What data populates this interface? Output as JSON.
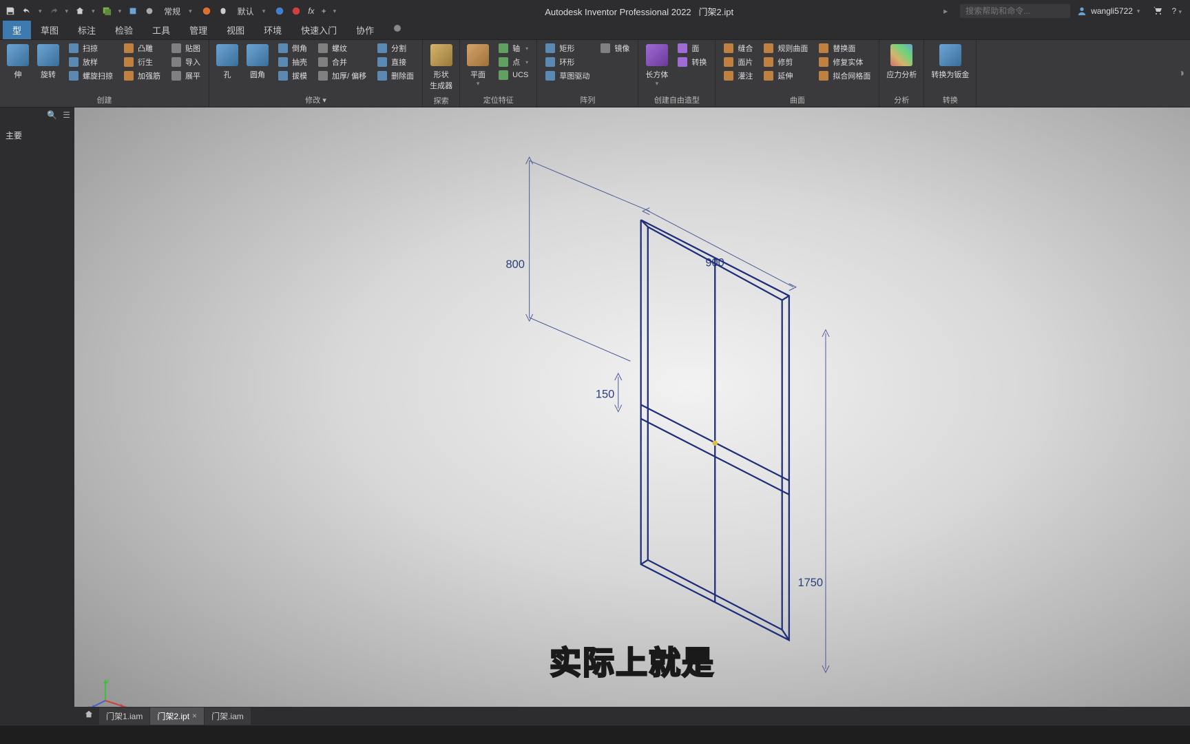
{
  "app": {
    "title": "Autodesk Inventor Professional 2022",
    "filename": "门架2.ipt",
    "search_placeholder": "搜索帮助和命令...",
    "username": "wangli5722"
  },
  "qat_dropdowns": {
    "style": "常规",
    "appearance": "默认"
  },
  "menu_tabs": [
    "型",
    "草图",
    "标注",
    "检验",
    "工具",
    "管理",
    "视图",
    "环境",
    "快速入门",
    "协作"
  ],
  "ribbon": {
    "panel_create": {
      "label": "创建",
      "large": [
        "伸",
        "旋转"
      ],
      "small_1": [
        "扫掠",
        "放样",
        "螺旋扫掠"
      ],
      "small_2": [
        "凸雕",
        "衍生",
        "加强筋"
      ],
      "small_3": [
        "贴图",
        "导入",
        "展平"
      ]
    },
    "panel_modify": {
      "label": "修改 ▾",
      "large": [
        "孔",
        "圆角"
      ],
      "small_1": [
        "倒角",
        "抽壳",
        "拔模"
      ],
      "small_2": [
        "螺纹",
        "合并",
        "加厚/ 偏移"
      ],
      "small_3": [
        "分割",
        "直接",
        "删除面"
      ]
    },
    "panel_explore": {
      "label": "探索",
      "large": [
        "形状\n生成器"
      ]
    },
    "panel_locate": {
      "label": "定位特征",
      "large": [
        "平面"
      ],
      "small": [
        "轴",
        "点",
        "UCS"
      ]
    },
    "panel_pattern": {
      "label": "阵列",
      "small": [
        "矩形",
        "环形",
        "草图驱动"
      ],
      "mirror": "镜像"
    },
    "panel_freeform": {
      "label": "创建自由造型",
      "large": [
        "长方体"
      ],
      "small": [
        "面",
        "转换"
      ]
    },
    "panel_surface": {
      "label": "曲面",
      "small_1": [
        "缝合",
        "面片",
        "灌注"
      ],
      "small_2": [
        "规则曲面",
        "修剪",
        "延伸"
      ],
      "small_3": [
        "替换面",
        "修复实体",
        "拟合网格面"
      ]
    },
    "panel_analysis": {
      "label": "分析",
      "large": [
        "应力分析"
      ]
    },
    "panel_convert": {
      "label": "转换",
      "large": [
        "转换为钣金"
      ]
    }
  },
  "browser": {
    "primary": "主要"
  },
  "dimensions": {
    "d800": "800",
    "d900": "900",
    "d150": "150",
    "d1750": "1750"
  },
  "axes": {
    "x": "x",
    "y": "y",
    "z": "z"
  },
  "subtitle": "实际上就是",
  "filetabs": [
    {
      "label": "门架1.iam",
      "active": false
    },
    {
      "label": "门架2.ipt",
      "active": true
    },
    {
      "label": "门架.iam",
      "active": false
    }
  ]
}
